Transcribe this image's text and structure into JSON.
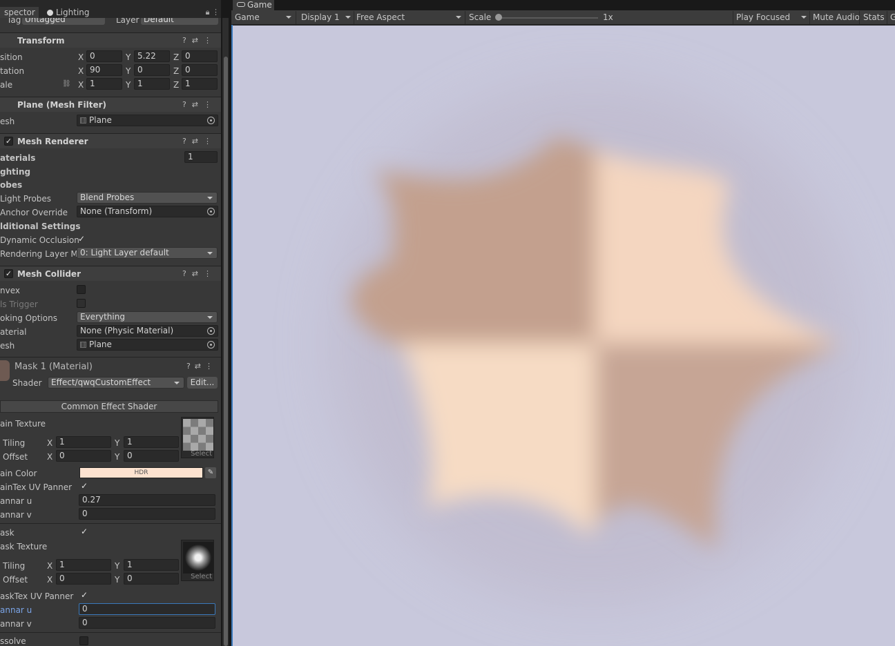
{
  "inspector": {
    "tab_inspector": "spector",
    "tab_lighting": "Lighting",
    "tag_label": "Tag",
    "tag_value": "Untagged",
    "layer_label": "Layer",
    "layer_value": "Default"
  },
  "transform": {
    "title": "Transform",
    "rows": [
      {
        "label": "sition",
        "x": "0",
        "y": "5.22",
        "z": "0"
      },
      {
        "label": "tation",
        "x": "90",
        "y": "0",
        "z": "0"
      },
      {
        "label": "ale",
        "x": "1",
        "y": "1",
        "z": "1"
      }
    ]
  },
  "mesh_filter": {
    "title": "Plane (Mesh Filter)",
    "mesh_label": "esh",
    "mesh_value": "Plane"
  },
  "mesh_renderer": {
    "title": "Mesh Renderer",
    "materials_label": "aterials",
    "materials_count": "1",
    "lighting_label": "ghting",
    "probes_label": "obes",
    "light_probes_label": "Light Probes",
    "light_probes_value": "Blend Probes",
    "anchor_label": "Anchor Override",
    "anchor_value": "None (Transform)",
    "additional_label": "lditional Settings",
    "dyn_occ_label": "Dynamic Occlusion",
    "render_layer_label": "Rendering Layer Ma",
    "render_layer_value": "0: Light Layer default"
  },
  "mesh_collider": {
    "title": "Mesh Collider",
    "convex_label": "nvex",
    "trigger_label": "ls Trigger",
    "cooking_label": "oking Options",
    "cooking_value": "Everything",
    "material_label": "aterial",
    "material_value": "None (Physic Material)",
    "mesh_label": "esh",
    "mesh_value": "Plane"
  },
  "material": {
    "title": "Mask 1 (Material)",
    "shader_label": "Shader",
    "shader_value": "Effect/qwqCustomEffect",
    "edit_label": "Edit...",
    "section_title": "Common Effect Shader",
    "main_tex_label": "ain Texture",
    "tiling_label": "Tiling",
    "offset_label": "Offset",
    "main_tiling_x": "1",
    "main_tiling_y": "1",
    "main_offset_x": "0",
    "main_offset_y": "0",
    "select_label": "Select",
    "main_color_label": "ain Color",
    "hdr_label": "HDR",
    "main_color": "#fde3d0",
    "main_panner_label": "ainTex UV Panner",
    "pannar_u_label": "annar u",
    "pannar_v_label": "annar v",
    "main_pannar_u": "0.27",
    "main_pannar_v": "0",
    "mask_label": "ask",
    "mask_tex_label": "ask Texture",
    "mask_tiling_x": "1",
    "mask_tiling_y": "1",
    "mask_offset_x": "0",
    "mask_offset_y": "0",
    "mask_panner_label": "askTex UV Panner",
    "mask_pannar_u": "0",
    "mask_pannar_v": "0",
    "dissolve_label": "ssolve"
  },
  "axis_labels": {
    "x": "X",
    "y": "Y",
    "z": "Z"
  },
  "game": {
    "tab_title": "Game",
    "mode": "Game",
    "display": "Display 1",
    "aspect": "Free Aspect",
    "scale_label": "Scale",
    "scale_value": "1x",
    "play_focused": "Play Focused",
    "mute_audio": "Mute Audio",
    "stats": "Stats",
    "gizmos_partial": "G",
    "background_color": "#c8c8dc"
  }
}
